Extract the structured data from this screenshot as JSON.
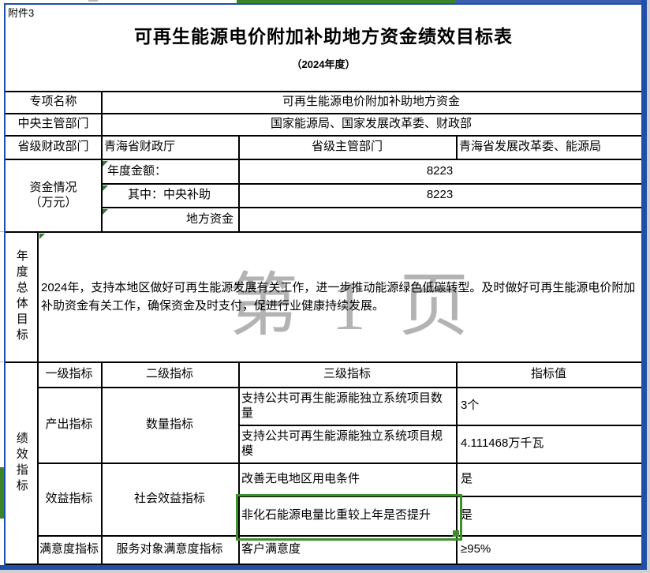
{
  "attachment_label": "附件3",
  "title": "可再生能源电价附加补助地方资金绩效目标表",
  "subtitle": "（2024年度）",
  "watermark_text": "第 1 页",
  "colors": {
    "page_border_blue": "#1f4fa8",
    "selection_green": "#3e8e2a",
    "header_highlight_green": "#3c8527",
    "watermark_gray": "#b3b3b3",
    "gridline_black": "#000000"
  },
  "info": {
    "special_project_label": "专项名称",
    "special_project_value": "可再生能源电价附加补助地方资金",
    "central_dept_label": "中央主管部门",
    "central_dept_value": "国家能源局、国家发展改革委、财政部",
    "provincial_finance_label": "省级财政部门",
    "provincial_finance_value": "青海省财政厅",
    "provincial_dept_label": "省级主管部门",
    "provincial_dept_value": "青海省发展改革委、能源局"
  },
  "funding": {
    "group_label_line1": "资金情况",
    "group_label_line2": "（万元）",
    "rows": [
      {
        "label": "年度金额：",
        "value": "8223"
      },
      {
        "label": "其中：中央补助",
        "value": "8223"
      },
      {
        "label": "地方资金",
        "value": ""
      }
    ]
  },
  "annual_goal": {
    "label": "年度总体目标",
    "text": "2024年，支持本地区做好可再生能源发展有关工作，进一步推动能源绿色低碳转型。及时做好可再生能源电价附加补助资金有关工作，确保资金及时支付，促进行业健康持续发展。"
  },
  "indicators": {
    "group_label": "绩效指标",
    "headers": [
      "一级指标",
      "二级指标",
      "三级指标",
      "指标值"
    ],
    "level1": [
      "产出指标",
      "效益指标",
      "满意度指标"
    ],
    "level2": [
      "数量指标",
      "社会效益指标",
      "服务对象满意度指标"
    ],
    "rows": [
      {
        "indicator": "支持公共可再生能源能独立系统项目数量",
        "value": "3个"
      },
      {
        "indicator": "支持公共可再生能源能独立系统项目规模",
        "value": "4.111468万千瓦"
      },
      {
        "indicator": "改善无电地区用电条件",
        "value": "是"
      },
      {
        "indicator": "非化石能源电量比重较上年是否提升",
        "value": "是",
        "selected": "true"
      },
      {
        "indicator": "客户满意度",
        "value": "≥95%"
      }
    ]
  }
}
